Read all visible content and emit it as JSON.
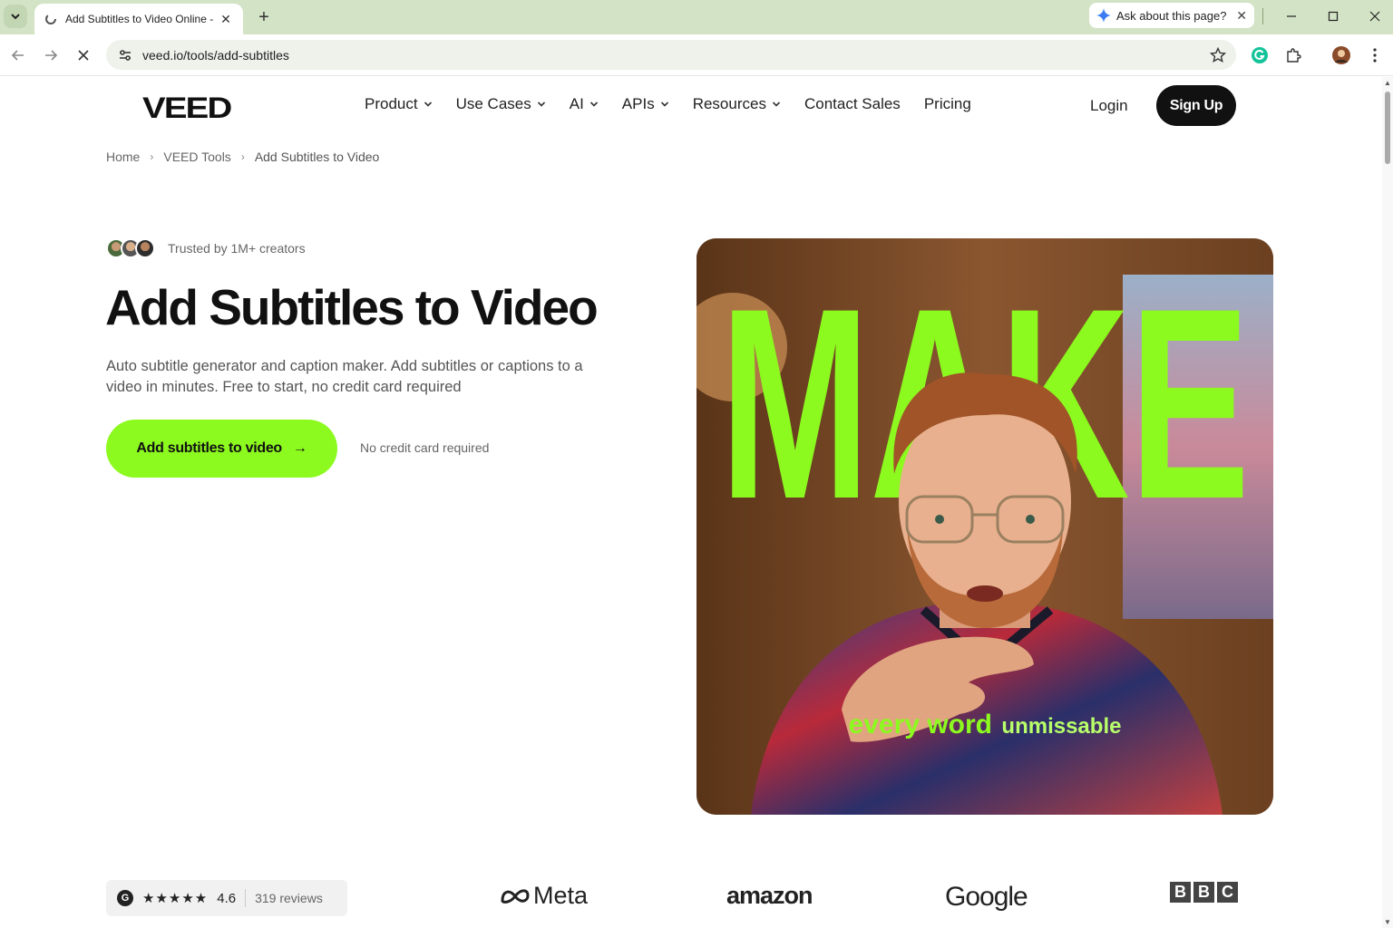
{
  "browser": {
    "tab_title": "Add Subtitles to Video Online -",
    "ask_label": "Ask about this page?",
    "url": "veed.io/tools/add-subtitles"
  },
  "header": {
    "logo": "VEED",
    "nav": [
      {
        "label": "Product",
        "has_menu": true
      },
      {
        "label": "Use Cases",
        "has_menu": true
      },
      {
        "label": "AI",
        "has_menu": true
      },
      {
        "label": "APIs",
        "has_menu": true
      },
      {
        "label": "Resources",
        "has_menu": true
      },
      {
        "label": "Contact Sales",
        "has_menu": false
      },
      {
        "label": "Pricing",
        "has_menu": false
      }
    ],
    "login": "Login",
    "signup": "Sign Up"
  },
  "breadcrumb": [
    "Home",
    "VEED Tools",
    "Add Subtitles to Video"
  ],
  "hero": {
    "trusted": "Trusted by 1M+ creators",
    "title": "Add Subtitles to Video",
    "subtitle": "Auto subtitle generator and caption maker. Add subtitles or captions to a video in minutes. Free to start, no credit card required",
    "cta": "Add subtitles to video",
    "no_card": "No credit card required",
    "image": {
      "overlay_text": "MAKE",
      "caption_highlight": "every word",
      "caption_rest": "unmissable",
      "accent": "#8cfa1f"
    }
  },
  "social_proof": {
    "g2_badge": "G",
    "stars": "★★★★★",
    "score": "4.6",
    "reviews": "319 reviews",
    "logos": [
      "Meta",
      "amazon",
      "Google",
      "BBC"
    ]
  },
  "colors": {
    "accent_green": "#8cfa1f",
    "chrome_green": "#d3e3c6",
    "dark": "#111111"
  }
}
